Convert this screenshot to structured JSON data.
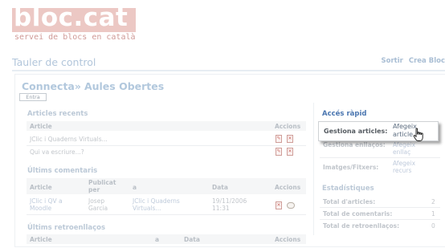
{
  "header": {
    "logo": "bloc.cat",
    "tagline": "servei de blocs en català",
    "page_title": "Tauler de control",
    "links": [
      "Sortir",
      "Crea Bloc"
    ]
  },
  "breadcrumb": {
    "part1": "Connecta»",
    "part2": "Aules Obertes"
  },
  "entra_button": "Entra",
  "articles": {
    "title": "Articles recents",
    "headers": {
      "article": "Article",
      "actions": "Accions"
    },
    "rows": [
      "JClic i Quaderns Virtuals...",
      "Qui va escriure...?"
    ]
  },
  "comments": {
    "title": "Últims comentaris",
    "headers": {
      "article": "Article",
      "publicat": "Publicat per",
      "a": "a",
      "data": "Data",
      "actions": "Accions"
    },
    "row": {
      "article": "JClic i QV a Moodle",
      "publicat": "Josep Garcia",
      "a": "JClic i Quaderns Virtuals...",
      "data": "19/11/2006 11:31"
    }
  },
  "retroenllacos": {
    "title": "Últims retroenllaços",
    "headers": {
      "article": "Article",
      "a": "a",
      "data": "Data",
      "actions": "Accions"
    }
  },
  "quick_access": {
    "title": "Accés ràpid",
    "items": [
      {
        "label": "Gestiona articles:",
        "link": "Afegeix article"
      },
      {
        "label": "Gestiona enllaços:",
        "link": "Afegeix enllaç"
      },
      {
        "label": "Imatges/Fitxers:",
        "link": "Afegeix recurs"
      }
    ]
  },
  "stats": {
    "title": "Estadístiques",
    "items": [
      {
        "label": "Total d'articles:",
        "value": "2"
      },
      {
        "label": "Total de comentaris:",
        "value": "1"
      },
      {
        "label": "Total de retroenllaços:",
        "value": "0"
      }
    ]
  },
  "colors": {
    "logo_bg": "#ecc8c4",
    "accent_blue": "#4a76b0",
    "faded_blue": "#b2c6db"
  }
}
